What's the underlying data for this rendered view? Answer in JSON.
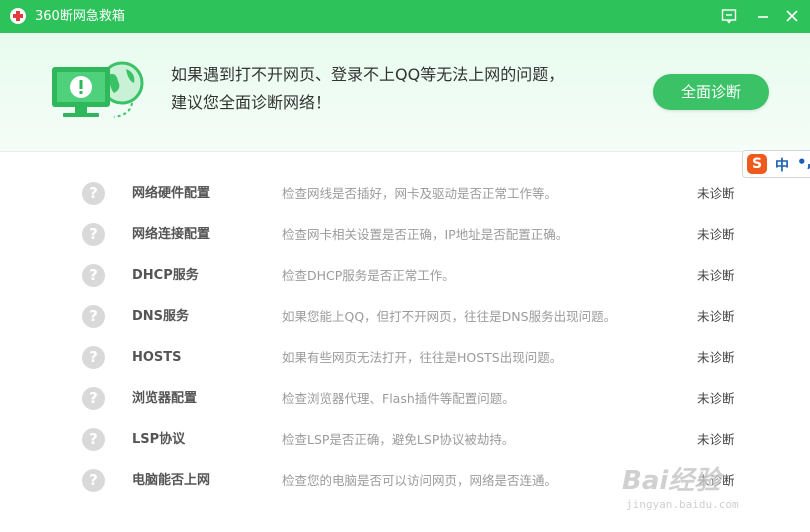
{
  "window": {
    "title": "360断网急救箱",
    "colors": {
      "titlebar": "#2ec25a",
      "accent": "#3bc266"
    },
    "controls": [
      "feedback-icon",
      "minimize-icon",
      "close-icon"
    ]
  },
  "banner": {
    "line1": "如果遇到打不开网页、登录不上QQ等无法上网的问题，",
    "line2": "建议您全面诊断网络！",
    "button_label": "全面诊断",
    "illustration_icon": "computer-globe-alert-icon"
  },
  "ime": {
    "logo": "S",
    "lang": "中",
    "punct": "•,"
  },
  "items": [
    {
      "name": "网络硬件配置",
      "desc": "检查网线是否插好，网卡及驱动是否正常工作等。",
      "status": "未诊断"
    },
    {
      "name": "网络连接配置",
      "desc": "检查网卡相关设置是否正确，IP地址是否配置正确。",
      "status": "未诊断"
    },
    {
      "name": "DHCP服务",
      "desc": "检查DHCP服务是否正常工作。",
      "status": "未诊断"
    },
    {
      "name": "DNS服务",
      "desc": "如果您能上QQ，但打不开网页，往往是DNS服务出现问题。",
      "status": "未诊断"
    },
    {
      "name": "HOSTS",
      "desc": "如果有些网页无法打开，往往是HOSTS出现问题。",
      "status": "未诊断"
    },
    {
      "name": "浏览器配置",
      "desc": "检查浏览器代理、Flash插件等配置问题。",
      "status": "未诊断"
    },
    {
      "name": "LSP协议",
      "desc": "检查LSP是否正确，避免LSP协议被劫持。",
      "status": "未诊断"
    },
    {
      "name": "电脑能否上网",
      "desc": "检查您的电脑是否可以访问网页，网络是否连通。",
      "status": "未诊断"
    }
  ],
  "item_icon": "question-icon",
  "watermark": {
    "brand": "Bai经验",
    "url": "jingyan.baidu.com"
  }
}
